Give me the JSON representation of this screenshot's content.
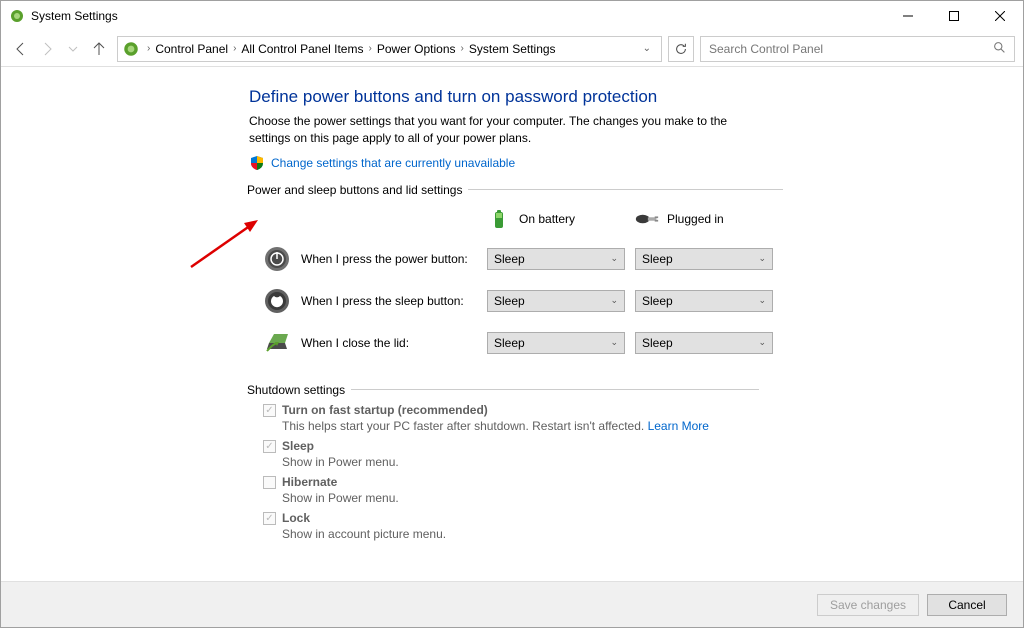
{
  "window": {
    "title": "System Settings"
  },
  "breadcrumbs": {
    "0": "Control Panel",
    "1": "All Control Panel Items",
    "2": "Power Options",
    "3": "System Settings"
  },
  "search": {
    "placeholder": "Search Control Panel"
  },
  "page": {
    "title": "Define power buttons and turn on password protection",
    "desc": "Choose the power settings that you want for your computer. The changes you make to the settings on this page apply to all of your power plans.",
    "change_link": "Change settings that are currently unavailable"
  },
  "fieldset1": {
    "legend": "Power and sleep buttons and lid settings"
  },
  "cols": {
    "battery": "On battery",
    "plugged": "Plugged in"
  },
  "rows": {
    "power": {
      "label": "When I press the power button:",
      "battery": "Sleep",
      "plugged": "Sleep"
    },
    "sleep": {
      "label": "When I press the sleep button:",
      "battery": "Sleep",
      "plugged": "Sleep"
    },
    "lid": {
      "label": "When I close the lid:",
      "battery": "Sleep",
      "plugged": "Sleep"
    }
  },
  "fieldset2": {
    "legend": "Shutdown settings"
  },
  "shutdown": {
    "fast": {
      "label": "Turn on fast startup (recommended)",
      "desc": "This helps start your PC faster after shutdown. Restart isn't affected. ",
      "learn": "Learn More"
    },
    "sleep": {
      "label": "Sleep",
      "desc": "Show in Power menu."
    },
    "hiber": {
      "label": "Hibernate",
      "desc": "Show in Power menu."
    },
    "lock": {
      "label": "Lock",
      "desc": "Show in account picture menu."
    }
  },
  "footer": {
    "save": "Save changes",
    "cancel": "Cancel"
  }
}
